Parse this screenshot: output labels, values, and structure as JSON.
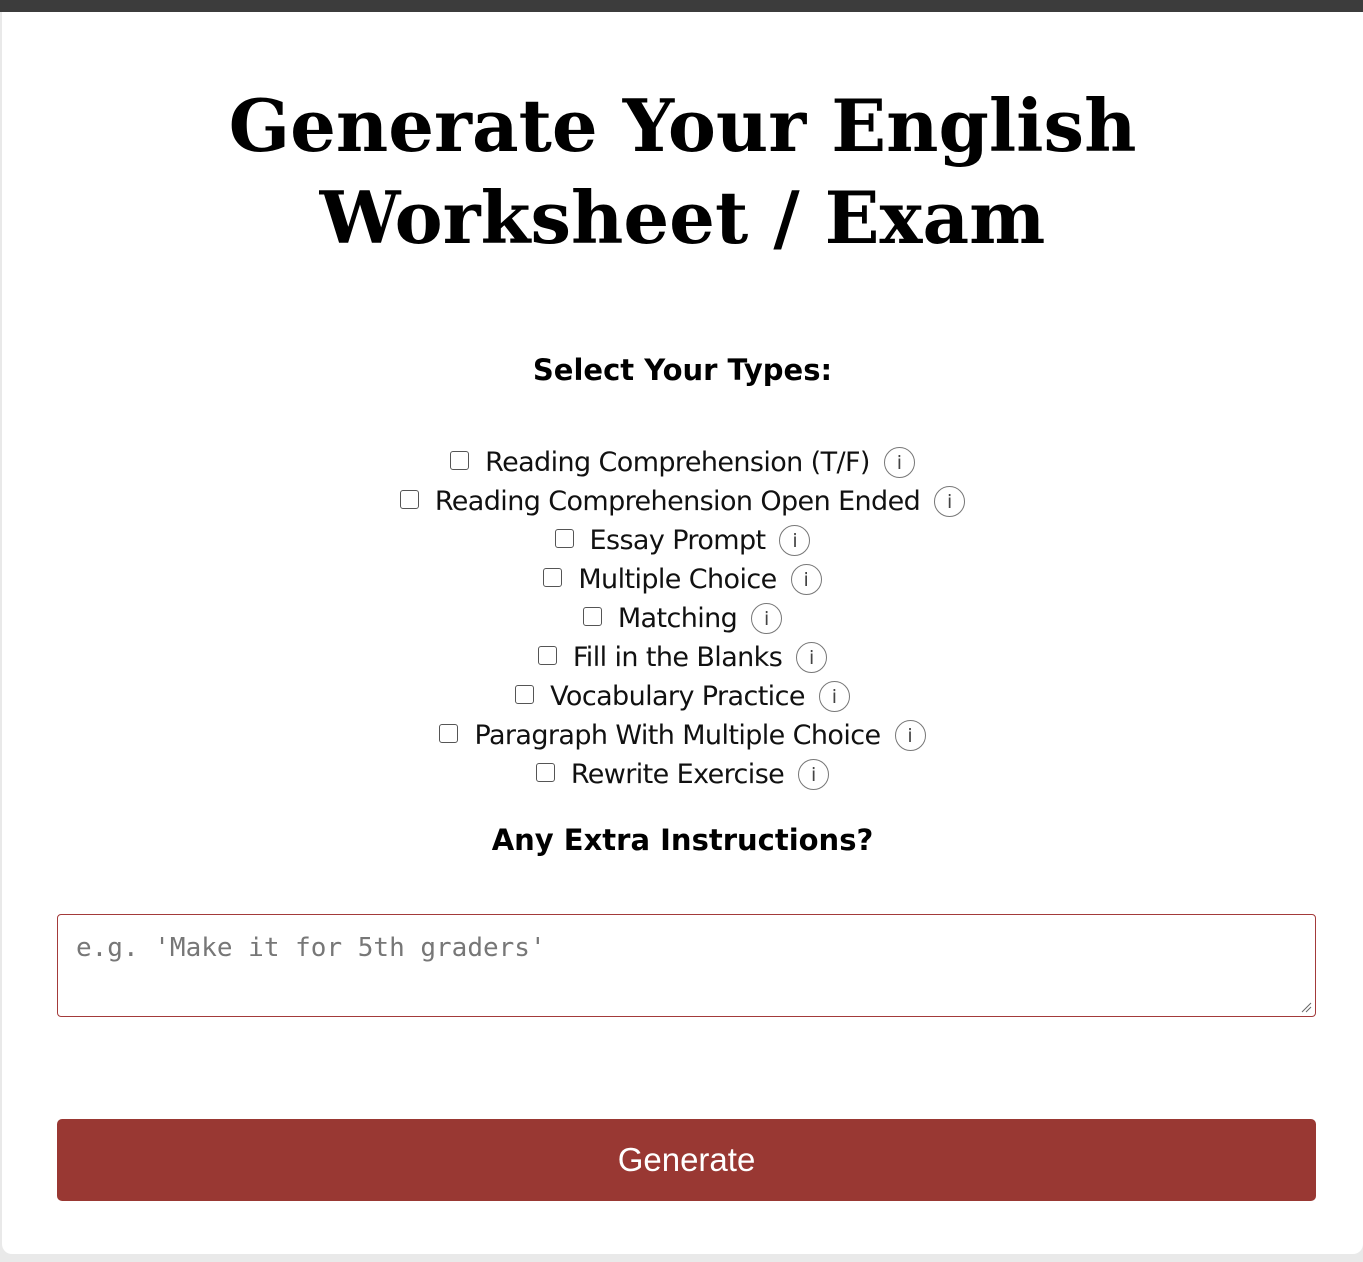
{
  "page_title": "Generate Your English Worksheet / Exam",
  "types_heading": "Select Your Types:",
  "types": [
    {
      "label": "Reading Comprehension (T/F)",
      "checked": false,
      "info": "i"
    },
    {
      "label": "Reading Comprehension Open Ended",
      "checked": false,
      "info": "i"
    },
    {
      "label": "Essay Prompt",
      "checked": false,
      "info": "i"
    },
    {
      "label": "Multiple Choice",
      "checked": false,
      "info": "i"
    },
    {
      "label": "Matching",
      "checked": false,
      "info": "i"
    },
    {
      "label": "Fill in the Blanks",
      "checked": false,
      "info": "i"
    },
    {
      "label": "Vocabulary Practice",
      "checked": false,
      "info": "i"
    },
    {
      "label": "Paragraph With Multiple Choice",
      "checked": false,
      "info": "i"
    },
    {
      "label": "Rewrite Exercise",
      "checked": false,
      "info": "i"
    }
  ],
  "extra_heading": "Any Extra Instructions?",
  "instructions": {
    "value": "",
    "placeholder": "e.g. 'Make it for 5th graders'"
  },
  "generate_label": "Generate",
  "colors": {
    "accent": "#993833",
    "top_bar": "#3c3c3c"
  },
  "icons": {
    "info": "info-icon"
  }
}
